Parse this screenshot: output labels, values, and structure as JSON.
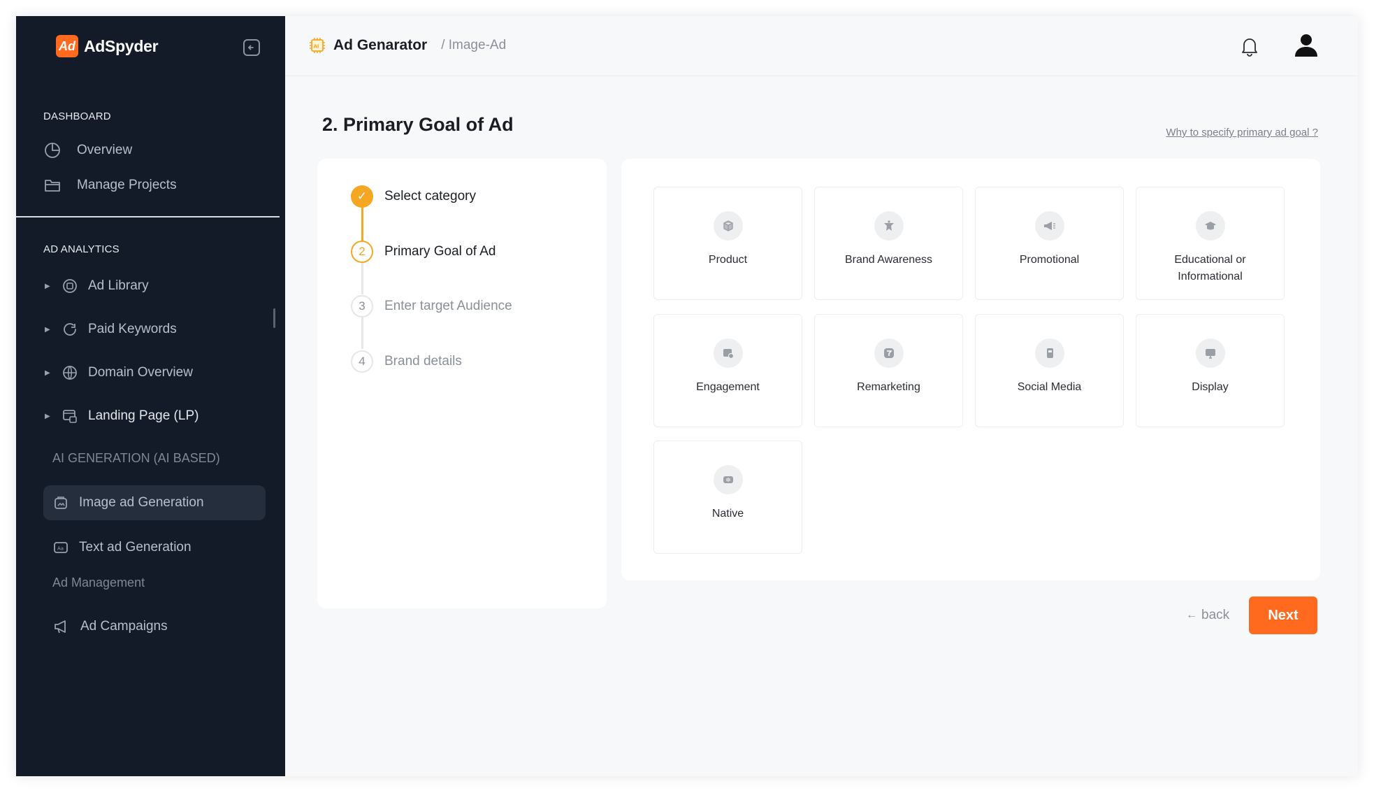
{
  "app": {
    "brand": "AdSpyder",
    "logo_glyph": "Ad"
  },
  "sidebar": {
    "dashboard_label": "DASHBOARD",
    "dashboard_items": [
      {
        "label": "Overview",
        "icon": "pie-chart-icon"
      },
      {
        "label": "Manage Projects",
        "icon": "folder-icon"
      }
    ],
    "analytics_label": "AD ANALYTICS",
    "analytics_items": [
      {
        "label": "Ad Library",
        "icon": "ad-library-icon"
      },
      {
        "label": "Paid Keywords",
        "icon": "paid-keywords-icon"
      },
      {
        "label": "Domain Overview",
        "icon": "globe-icon"
      },
      {
        "label": "Landing Page (LP)",
        "icon": "landing-page-icon"
      }
    ],
    "ai_label": "AI GENERATION (AI BASED)",
    "ai_items": [
      {
        "label": "Image ad Generation",
        "icon": "image-ad-icon",
        "active": true
      },
      {
        "label": "Text ad Generation",
        "icon": "text-ad-icon"
      }
    ],
    "management_label": "Ad Management",
    "management_items": [
      {
        "label": "Ad Campaigns",
        "icon": "megaphone-icon"
      }
    ]
  },
  "header": {
    "title": "Ad Genarator",
    "breadcrumb": "/ Image-Ad"
  },
  "main": {
    "page_title": "2. Primary Goal of Ad",
    "help_link": "Why to specify primary ad goal ?",
    "steps": [
      {
        "number": "✓",
        "label": "Select category",
        "state": "done"
      },
      {
        "number": "2",
        "label": "Primary Goal of Ad",
        "state": "active"
      },
      {
        "number": "3",
        "label": "Enter target Audience",
        "state": "pending"
      },
      {
        "number": "4",
        "label": "Brand details",
        "state": "pending"
      }
    ],
    "options": [
      {
        "label": "Product",
        "icon": "box-icon"
      },
      {
        "label": "Brand Awareness",
        "icon": "brand-awareness-icon"
      },
      {
        "label": "Promotional",
        "icon": "megaphone-icon"
      },
      {
        "label": "Educational or Informational",
        "icon": "graduation-cap-icon"
      },
      {
        "label": "Engagement",
        "icon": "engagement-icon"
      },
      {
        "label": "Remarketing",
        "icon": "remarketing-icon"
      },
      {
        "label": "Social Media",
        "icon": "mobile-icon"
      },
      {
        "label": "Display",
        "icon": "monitor-icon"
      },
      {
        "label": "Native",
        "icon": "native-icon"
      }
    ],
    "back_label": "back",
    "next_label": "Next"
  },
  "colors": {
    "accent": "#ff6a1f",
    "step_active": "#f5a623",
    "sidebar_bg": "#131b29"
  }
}
